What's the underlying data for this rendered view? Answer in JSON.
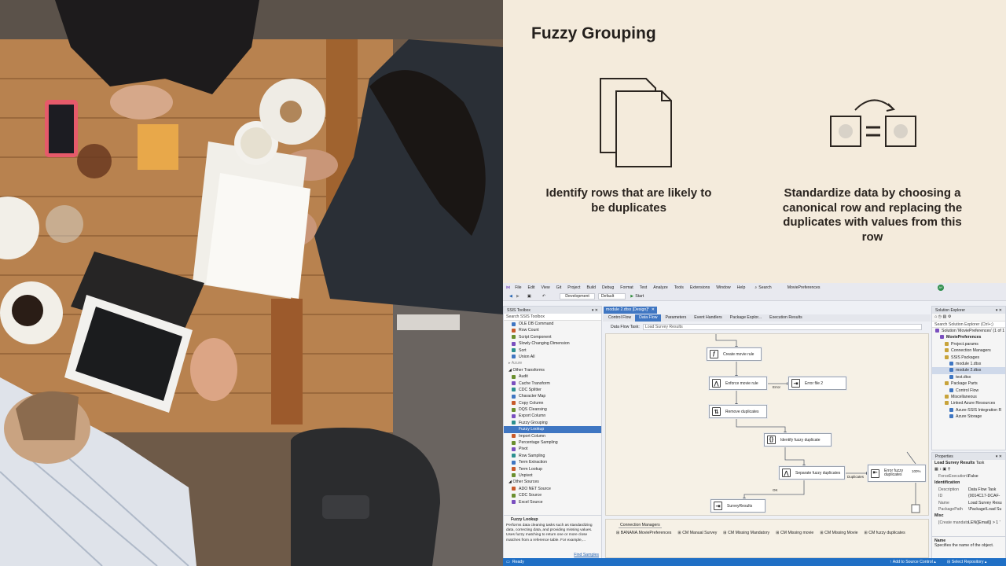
{
  "slide": {
    "title": "Fuzzy Grouping",
    "caption_left": "Identify rows that are likely to be duplicates",
    "caption_right": "Standardize data by choosing a canonical row and replacing the duplicates with values from this row"
  },
  "vs": {
    "menu": [
      "File",
      "Edit",
      "View",
      "Git",
      "Project",
      "Build",
      "Debug",
      "Format",
      "Test",
      "Analyze",
      "Tools",
      "Extensions",
      "Window",
      "Help"
    ],
    "search_label": "Search",
    "project_name": "MoviePreferences",
    "user_initials": "AY",
    "config": "Development",
    "platform": "Default",
    "start_label": "Start",
    "toolbox": {
      "title": "SSIS Toolbox",
      "search_placeholder": "Search SSIS Toolbox",
      "common_items": [
        "OLE DB Command",
        "Row Count",
        "Script Component",
        "Slowly Changing Dimension",
        "Sort",
        "Union All"
      ],
      "azure_group": "Azure",
      "other_transforms_group": "Other Transforms",
      "other_transforms": [
        "Audit",
        "Cache Transform",
        "CDC Splitter",
        "Character Map",
        "Copy Column",
        "DQS Cleansing",
        "Export Column",
        "Fuzzy Grouping",
        "Fuzzy Lookup",
        "Import Column",
        "Percentage Sampling",
        "Pivot",
        "Row Sampling",
        "Term Extraction",
        "Term Lookup",
        "Unpivot"
      ],
      "selected_item": "Fuzzy Lookup",
      "other_sources_group": "Other Sources",
      "other_sources": [
        "ADO NET Source",
        "CDC Source",
        "Excel Source"
      ],
      "info_title": "Fuzzy Lookup",
      "info_text": "Performs data cleaning tasks such as standardizing data, correcting data, and providing missing values. Uses fuzzy matching to return one or more close matches from a reference table. For example,...",
      "find_samples": "Find Samples"
    },
    "doc_tab": "module 2.dtsx [Design]*",
    "designer_tabs": [
      "Control Flow",
      "Data Flow",
      "Parameters",
      "Event Handlers",
      "Package Explor...",
      "Execution Results"
    ],
    "active_designer_tab": "Data Flow",
    "dft_label": "Data Flow Task:",
    "dft_value": "Load Survey Results",
    "nodes": {
      "create_movie_rule": "Create movie rule",
      "enforce_movie_rule": "Enforce movie rule",
      "error_file": "Error file 2",
      "remove_duplicates": "Remove duplicates",
      "identify_fuzzy": "Identify fuzzy duplicate",
      "separate_fuzzy": "Separate fuzzy duplicates",
      "error_fuzzy": "Error fuzzy duplicates",
      "survey_results": "SurveyResults"
    },
    "edge_labels": {
      "error": "Error",
      "duplicates": "Duplicates",
      "ok": "OK"
    },
    "zoom": "100%",
    "connection_manager": {
      "title": "Connection Managers",
      "items": [
        "BANANA.MoviePreferences",
        "CM Manual Survey",
        "CM Missing Mandatory",
        "CM Missing movie",
        "CM Missing Movie",
        "CM fuzzy duplicates"
      ]
    },
    "solution_explorer": {
      "title": "Solution Explorer",
      "search_placeholder": "Search Solution Explorer (Ctrl+;)",
      "items": [
        {
          "label": "Solution 'MoviePreferences' (1 of 1",
          "depth": 0
        },
        {
          "label": "MoviePreferences",
          "depth": 1
        },
        {
          "label": "Project.params",
          "depth": 2
        },
        {
          "label": "Connection Managers",
          "depth": 2
        },
        {
          "label": "SSIS Packages",
          "depth": 2
        },
        {
          "label": "module 1.dtsx",
          "depth": 3
        },
        {
          "label": "module 2.dtsx",
          "depth": 3
        },
        {
          "label": "test.dtsx",
          "depth": 3
        },
        {
          "label": "Package Parts",
          "depth": 2
        },
        {
          "label": "Control Flow",
          "depth": 3
        },
        {
          "label": "Miscellaneous",
          "depth": 2
        },
        {
          "label": "Linked Azure Resources",
          "depth": 2
        },
        {
          "label": "Azure-SSIS Integration R",
          "depth": 3
        },
        {
          "label": "Azure Storage",
          "depth": 3
        }
      ],
      "selected": "module 2.dtsx"
    },
    "properties": {
      "title": "Properties",
      "object": "Load Survey Results",
      "object_type": "Task",
      "rows": [
        {
          "k": "ForceExecutionV",
          "v": "False",
          "cat": false
        },
        {
          "k": "Identification",
          "v": "",
          "cat": true
        },
        {
          "k": "Description",
          "v": "Data Flow Task",
          "cat": false
        },
        {
          "k": "ID",
          "v": "{0014C17-DCAF-",
          "cat": false
        },
        {
          "k": "Name",
          "v": "Load Survey Resu",
          "cat": false
        },
        {
          "k": "PackagePath",
          "v": "\\Package\\Load Su",
          "cat": false
        },
        {
          "k": "Misc",
          "v": "",
          "cat": true
        },
        {
          "k": "[Create mandato",
          "v": "LEN([Email]) > 1 '",
          "cat": false
        }
      ],
      "desc_title": "Name",
      "desc_text": "Specifies the name of the object."
    },
    "status": {
      "ready": "Ready",
      "source_control": "Add to Source Control",
      "repository": "Select Repository"
    }
  }
}
